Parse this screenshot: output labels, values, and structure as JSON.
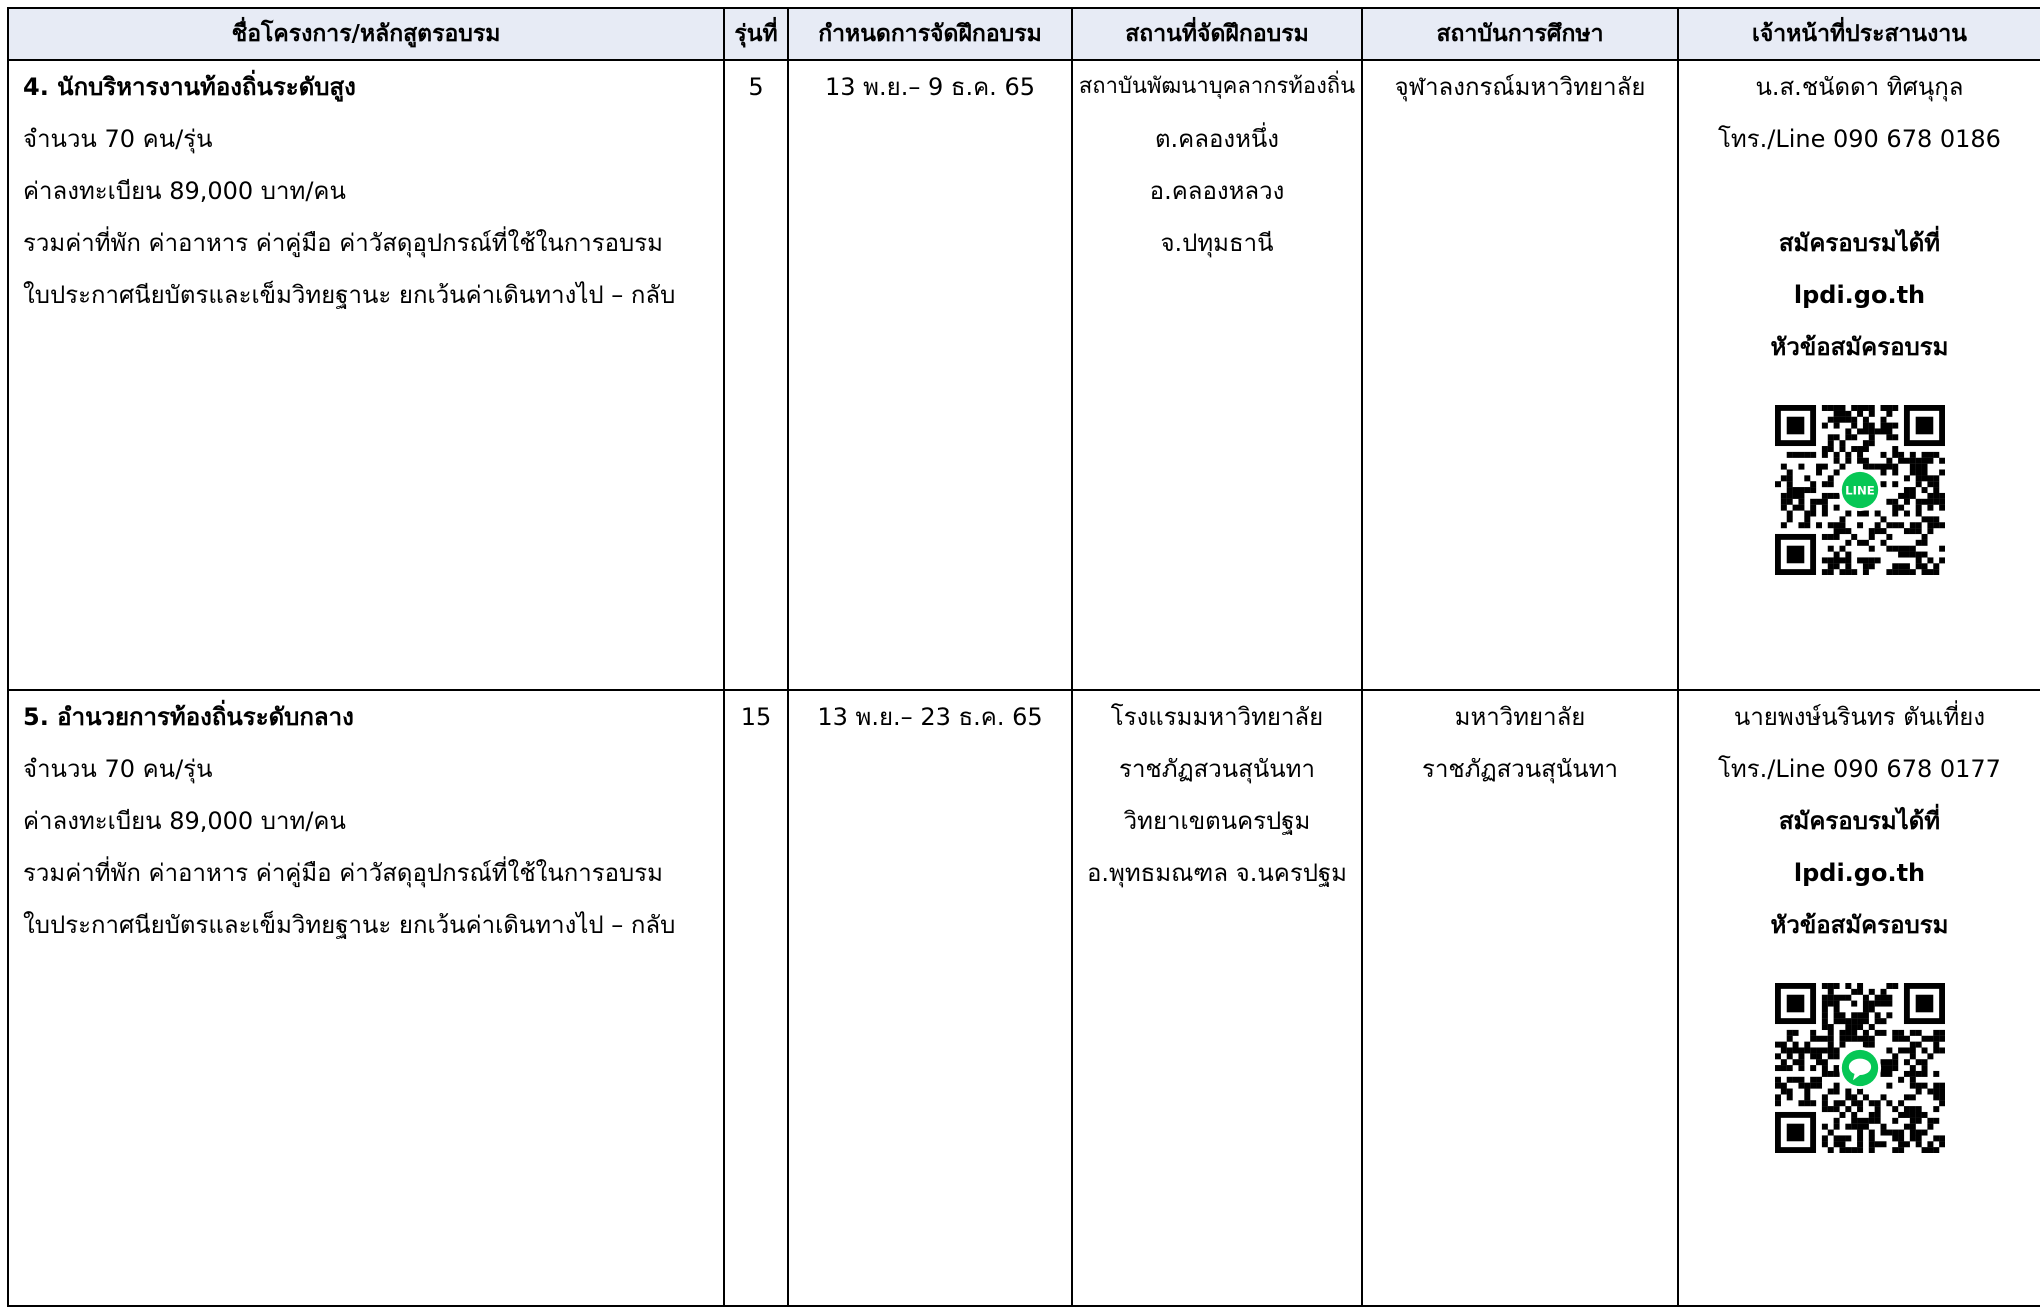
{
  "headers": {
    "course": "ชื่อโครงการ/หลักสูตรอบรม",
    "batch": "รุ่นที่",
    "schedule": "กำหนดการจัดฝึกอบรม",
    "venue": "สถานที่จัดฝึกอบรม",
    "institution": "สถาบันการศึกษา",
    "contact": "เจ้าหน้าที่ประสานงาน"
  },
  "rows": [
    {
      "title": "4. นักบริหารงานท้องถิ่นระดับสูง",
      "details": [
        "จำนวน 70 คน/รุ่น",
        "ค่าลงทะเบียน 89,000 บาท/คน",
        "รวมค่าที่พัก ค่าอาหาร ค่าคู่มือ ค่าวัสดุอุปกรณ์ที่ใช้ในการอบรม",
        "ใบประกาศนียบัตรและเข็มวิทยฐานะ ยกเว้นค่าเดินทางไป – กลับ"
      ],
      "batch": "5",
      "schedule": "13 พ.ย.– 9 ธ.ค. 65",
      "venue": [
        "สถาบันพัฒนาบุคลากรท้องถิ่น",
        "ต.คลองหนึ่ง",
        "อ.คลองหลวง",
        "จ.ปทุมธานี"
      ],
      "institution": [
        "จุฬาลงกรณ์มหาวิทยาลัย"
      ],
      "contact_name": "น.ส.ชนัดดา ทิศนุกุล",
      "contact_phone": "โทร./Line 090 678 0186",
      "apply_label": "สมัครอบรมได้ที่",
      "apply_site": "lpdi.go.th",
      "apply_topic": "หัวข้อสมัครอบรม",
      "qr_icon": "line-qr-code",
      "qr_badge_text": "LINE"
    },
    {
      "title": "5. อำนวยการท้องถิ่นระดับกลาง",
      "details": [
        "จำนวน 70 คน/รุ่น",
        "ค่าลงทะเบียน 89,000 บาท/คน",
        "รวมค่าที่พัก ค่าอาหาร ค่าคู่มือ ค่าวัสดุอุปกรณ์ที่ใช้ในการอบรม",
        "ใบประกาศนียบัตรและเข็มวิทยฐานะ ยกเว้นค่าเดินทางไป – กลับ"
      ],
      "batch": "15",
      "schedule": "13 พ.ย.– 23 ธ.ค. 65",
      "venue": [
        "โรงแรมมหาวิทยาลัย",
        "ราชภัฏสวนสุนันทา",
        "วิทยาเขตนครปฐม",
        "อ.พุทธมณฑล จ.นครปฐม"
      ],
      "institution": [
        "มหาวิทยาลัย",
        "ราชภัฏสวนสุนันทา"
      ],
      "contact_name": "นายพงษ์นรินทร ตันเที่ยง",
      "contact_phone": "โทร./Line 090 678 0177",
      "apply_label": "สมัครอบรมได้ที่",
      "apply_site": "lpdi.go.th",
      "apply_topic": "หัวข้อสมัครอบรม",
      "qr_icon": "line-qr-code",
      "qr_badge_text": ""
    }
  ],
  "colors": {
    "header_bg": "#e7ebf5",
    "line_green": "#06c755"
  }
}
